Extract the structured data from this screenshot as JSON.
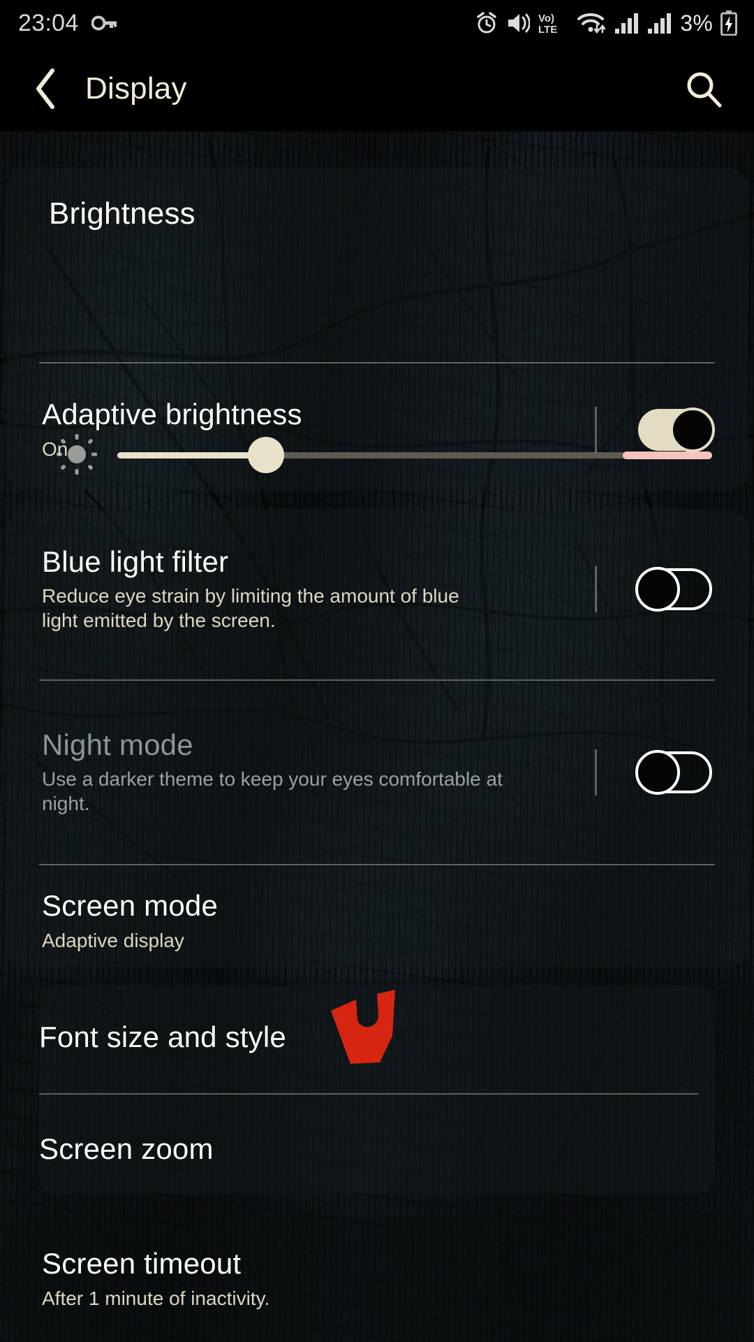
{
  "status_bar": {
    "time": "23:04",
    "battery_percent": "3%",
    "icons": [
      "vpn-key-icon",
      "alarm-icon",
      "vibrate-icon",
      "volte-icon",
      "wifi-icon",
      "signal-sim1-icon",
      "signal-sim2-icon",
      "battery-charging-icon"
    ]
  },
  "app_bar": {
    "title": "Display",
    "back_icon": "back-chevron-icon",
    "search_icon": "search-icon"
  },
  "brightness_card": {
    "heading": "Brightness",
    "slider": {
      "icon": "brightness-low-icon",
      "value_percent": 25,
      "max_zone_label": ""
    },
    "adaptive": {
      "title": "Adaptive brightness",
      "subtitle": "On",
      "toggle_state": "on"
    }
  },
  "filter_card": {
    "blue_light": {
      "title": "Blue light filter",
      "subtitle": "Reduce eye strain by limiting the amount of blue light emitted by the screen.",
      "toggle_state": "off"
    },
    "night_mode": {
      "title": "Night mode",
      "subtitle": "Use a darker theme to keep your eyes comfortable at night.",
      "toggle_state": "off",
      "disabled": true
    },
    "screen_mode": {
      "title": "Screen mode",
      "subtitle": "Adaptive display"
    }
  },
  "font_card": {
    "font_size": {
      "title": "Font size and style"
    },
    "screen_zoom": {
      "title": "Screen zoom"
    }
  },
  "timeout_card": {
    "screen_timeout": {
      "title": "Screen timeout",
      "subtitle": "After 1 minute of inactivity."
    }
  },
  "annotation": {
    "marker_color": "#d62612",
    "marker_name": "red-pointer-marker"
  },
  "colors": {
    "accent_cream": "#e4dcc2",
    "slider_max_pink": "#f9c3bd",
    "title_white": "#ffffff",
    "subtitle_cream": "#ded6bf",
    "disabled_gray": "#8d9396",
    "background": "#000000"
  }
}
